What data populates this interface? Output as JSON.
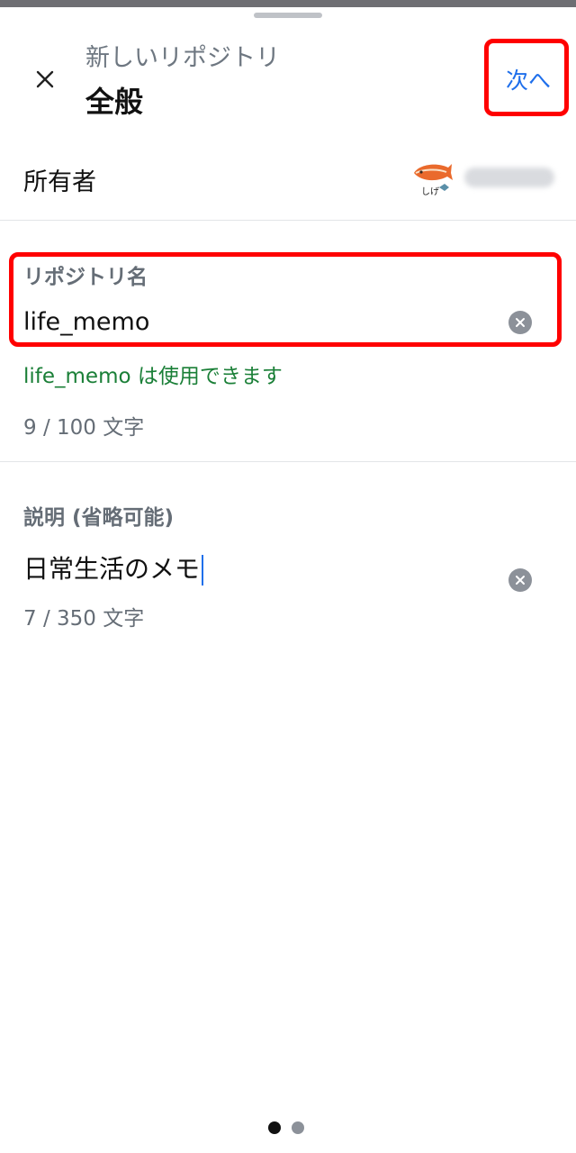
{
  "header": {
    "subtitle": "新しいリポジトリ",
    "title": "全般",
    "next_label": "次へ",
    "close_icon": "close-icon"
  },
  "owner": {
    "label": "所有者",
    "avatar_icon": "avatar",
    "avatar_caption": "しげ"
  },
  "repo_name": {
    "label": "リポジトリ名",
    "value": "life_memo",
    "availability": "life_memo は使用できます",
    "count": "9 / 100 文字"
  },
  "description": {
    "label": "説明 (省略可能)",
    "value": "日常生活のメモ",
    "count": "7 / 350 文字"
  },
  "pagination": {
    "current": 1,
    "total": 2
  },
  "colors": {
    "accent": "#1f6feb",
    "success": "#1a7f37",
    "muted": "#656d76",
    "highlight": "#ff0000",
    "dot_active": "#111111",
    "dot_inactive": "#8c9199"
  }
}
